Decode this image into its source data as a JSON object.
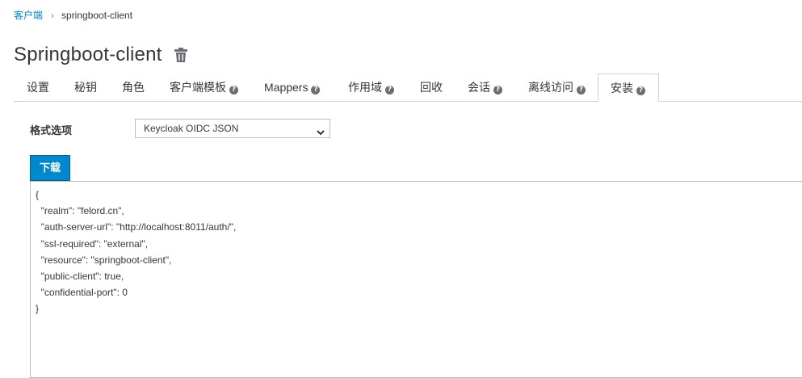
{
  "breadcrumb": {
    "parent": "客户端",
    "separator": "›",
    "current": "springboot-client"
  },
  "page": {
    "title": "Springboot-client",
    "delete_icon": "trash-icon"
  },
  "tabs": [
    {
      "label": "设置",
      "help": false
    },
    {
      "label": "秘钥",
      "help": false
    },
    {
      "label": "角色",
      "help": false
    },
    {
      "label": "客户端模板",
      "help": true
    },
    {
      "label": "Mappers",
      "help": true
    },
    {
      "label": "作用域",
      "help": true
    },
    {
      "label": "回收",
      "help": false
    },
    {
      "label": "会话",
      "help": true
    },
    {
      "label": "离线访问",
      "help": true
    },
    {
      "label": "安装",
      "help": true,
      "active": true
    }
  ],
  "form": {
    "format_label": "格式选项",
    "format_value": "Keycloak OIDC JSON"
  },
  "actions": {
    "download_label": "下载"
  },
  "config_lines": [
    "{",
    "  \"realm\": \"felord.cn\",",
    "  \"auth-server-url\": \"http://localhost:8011/auth/\",",
    "  \"ssl-required\": \"external\",",
    "  \"resource\": \"springboot-client\",",
    "  \"public-client\": true,",
    "  \"confidential-port\": 0",
    "}"
  ],
  "colors": {
    "accent": "#0088ce",
    "text": "#363636",
    "border": "#d1d1d1"
  }
}
